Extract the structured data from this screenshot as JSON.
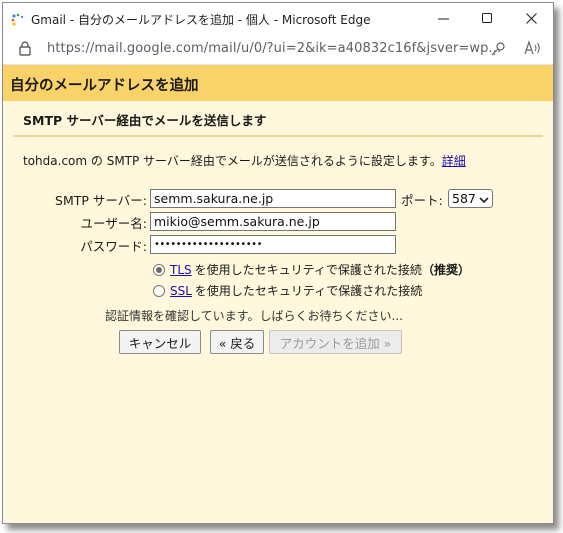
{
  "window": {
    "title": "Gmail - 自分のメールアドレスを追加 - 個人 - Microsoft Edge",
    "url": "https://mail.google.com/mail/u/0/?ui=2&ik=a40832c16f&jsver=wp..."
  },
  "header": {
    "title": "自分のメールアドレスを追加"
  },
  "section": {
    "title": "SMTP サーバー経由でメールを送信します",
    "description": "tohda.com の SMTP サーバー経由でメールが送信されるように設定します。",
    "details_link": "詳細"
  },
  "form": {
    "smtp_label": "SMTP サーバー:",
    "smtp_value": "semm.sakura.ne.jp",
    "port_label": "ポート:",
    "port_value": "587",
    "username_label": "ユーザー名:",
    "username_value": "mikio@semm.sakura.ne.jp",
    "password_label": "パスワード:",
    "password_value": "••••••••••••••••••••"
  },
  "security": {
    "tls_link": "TLS",
    "tls_text": "を使用したセキュリティで保護された接続",
    "tls_recommended": "（推奨）",
    "tls_checked": true,
    "ssl_link": "SSL",
    "ssl_text": "を使用したセキュリティで保護された接続",
    "ssl_checked": false
  },
  "status_text": "認証情報を確認しています。しばらくお待ちください...",
  "buttons": {
    "cancel": "キャンセル",
    "back": "« 戻る",
    "add_account": "アカウントを追加 »"
  },
  "colors": {
    "header_bg": "#f9d36a",
    "content_bg": "#fff8dc",
    "link": "#1a0dab"
  },
  "icons": [
    "gmail-app-icon",
    "minimize-icon",
    "maximize-icon",
    "close-icon",
    "lock-icon",
    "key-icon",
    "read-aloud-icon",
    "chevron-down-icon"
  ]
}
